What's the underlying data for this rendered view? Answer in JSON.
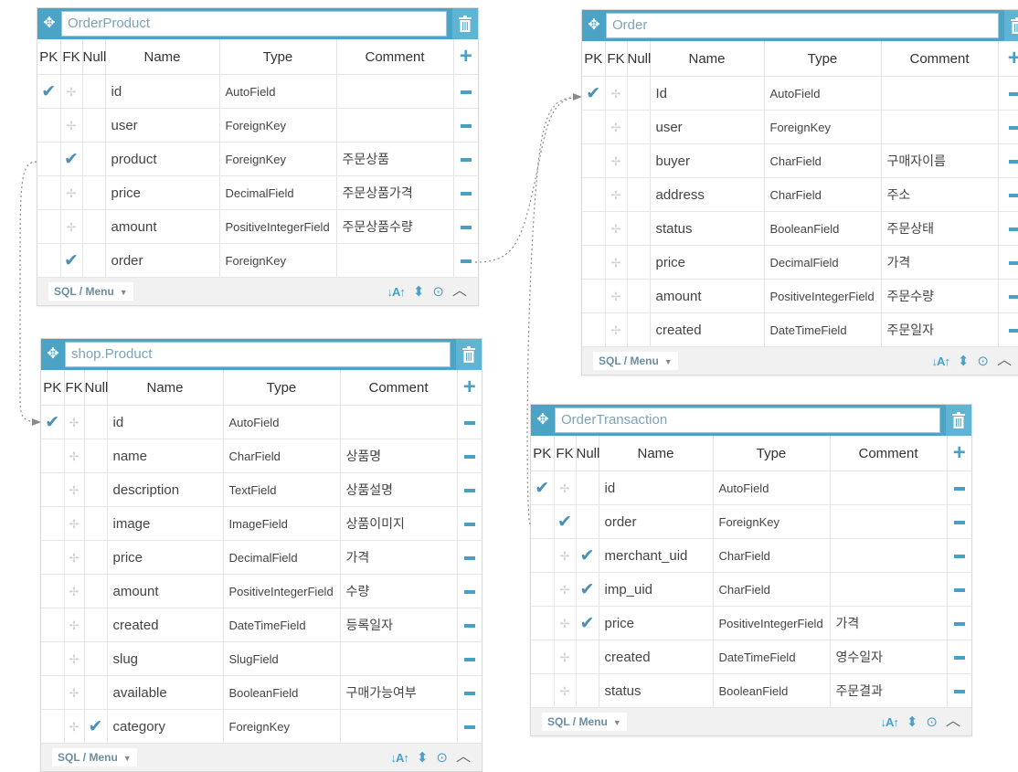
{
  "ui": {
    "pk_header": "PK",
    "fk_header": "FK",
    "null_header": "Null",
    "name_header": "Name",
    "type_header": "Type",
    "comment_header": "Comment",
    "footer_menu": "SQL / Menu",
    "accent_color": "#4ba3c6"
  },
  "tables": {
    "order_product": {
      "title": "OrderProduct",
      "fields": [
        {
          "pk": true,
          "fk": false,
          "null": false,
          "name": "id",
          "type": "AutoField",
          "comment": ""
        },
        {
          "pk": false,
          "fk": false,
          "null": false,
          "name": "user",
          "type": "ForeignKey",
          "comment": ""
        },
        {
          "pk": false,
          "fk": true,
          "null": false,
          "name": "product",
          "type": "ForeignKey",
          "comment": "주문상품"
        },
        {
          "pk": false,
          "fk": false,
          "null": false,
          "name": "price",
          "type": "DecimalField",
          "comment": "주문상품가격"
        },
        {
          "pk": false,
          "fk": false,
          "null": false,
          "name": "amount",
          "type": "PositiveIntegerField",
          "comment": "주문상품수량"
        },
        {
          "pk": false,
          "fk": true,
          "null": false,
          "name": "order",
          "type": "ForeignKey",
          "comment": ""
        }
      ]
    },
    "order": {
      "title": "Order",
      "fields": [
        {
          "pk": true,
          "fk": false,
          "null": false,
          "name": "Id",
          "type": "AutoField",
          "comment": ""
        },
        {
          "pk": false,
          "fk": false,
          "null": false,
          "name": "user",
          "type": "ForeignKey",
          "comment": ""
        },
        {
          "pk": false,
          "fk": false,
          "null": false,
          "name": "buyer",
          "type": "CharField",
          "comment": "구매자이름"
        },
        {
          "pk": false,
          "fk": false,
          "null": false,
          "name": "address",
          "type": "CharField",
          "comment": "주소"
        },
        {
          "pk": false,
          "fk": false,
          "null": false,
          "name": "status",
          "type": "BooleanField",
          "comment": "주문상태"
        },
        {
          "pk": false,
          "fk": false,
          "null": false,
          "name": "price",
          "type": "DecimalField",
          "comment": "가격"
        },
        {
          "pk": false,
          "fk": false,
          "null": false,
          "name": "amount",
          "type": "PositiveIntegerField",
          "comment": "주문수량"
        },
        {
          "pk": false,
          "fk": false,
          "null": false,
          "name": "created",
          "type": "DateTimeField",
          "comment": "주문일자"
        }
      ]
    },
    "product": {
      "title": "shop.Product",
      "fields": [
        {
          "pk": true,
          "fk": false,
          "null": false,
          "name": "id",
          "type": "AutoField",
          "comment": ""
        },
        {
          "pk": false,
          "fk": false,
          "null": false,
          "name": "name",
          "type": "CharField",
          "comment": "상품명"
        },
        {
          "pk": false,
          "fk": false,
          "null": false,
          "name": "description",
          "type": "TextField",
          "comment": "상품설명"
        },
        {
          "pk": false,
          "fk": false,
          "null": false,
          "name": "image",
          "type": "ImageField",
          "comment": "상품이미지"
        },
        {
          "pk": false,
          "fk": false,
          "null": false,
          "name": "price",
          "type": "DecimalField",
          "comment": "가격"
        },
        {
          "pk": false,
          "fk": false,
          "null": false,
          "name": "amount",
          "type": "PositiveIntegerField",
          "comment": "수량"
        },
        {
          "pk": false,
          "fk": false,
          "null": false,
          "name": "created",
          "type": "DateTimeField",
          "comment": "등록일자"
        },
        {
          "pk": false,
          "fk": false,
          "null": false,
          "name": "slug",
          "type": "SlugField",
          "comment": ""
        },
        {
          "pk": false,
          "fk": false,
          "null": false,
          "name": "available",
          "type": "BooleanField",
          "comment": "구매가능여부"
        },
        {
          "pk": false,
          "fk": false,
          "null": true,
          "name": "category",
          "type": "ForeignKey",
          "comment": ""
        }
      ]
    },
    "order_transaction": {
      "title": "OrderTransaction",
      "fields": [
        {
          "pk": true,
          "fk": false,
          "null": false,
          "name": "id",
          "type": "AutoField",
          "comment": ""
        },
        {
          "pk": false,
          "fk": true,
          "null": false,
          "name": "order",
          "type": "ForeignKey",
          "comment": ""
        },
        {
          "pk": false,
          "fk": false,
          "null": true,
          "name": "merchant_uid",
          "type": "CharField",
          "comment": ""
        },
        {
          "pk": false,
          "fk": false,
          "null": true,
          "name": "imp_uid",
          "type": "CharField",
          "comment": ""
        },
        {
          "pk": false,
          "fk": false,
          "null": true,
          "name": "price",
          "type": "PositiveIntegerField",
          "comment": "가격"
        },
        {
          "pk": false,
          "fk": false,
          "null": false,
          "name": "created",
          "type": "DateTimeField",
          "comment": "영수일자"
        },
        {
          "pk": false,
          "fk": false,
          "null": false,
          "name": "status",
          "type": "BooleanField",
          "comment": "주문결과"
        }
      ]
    }
  }
}
